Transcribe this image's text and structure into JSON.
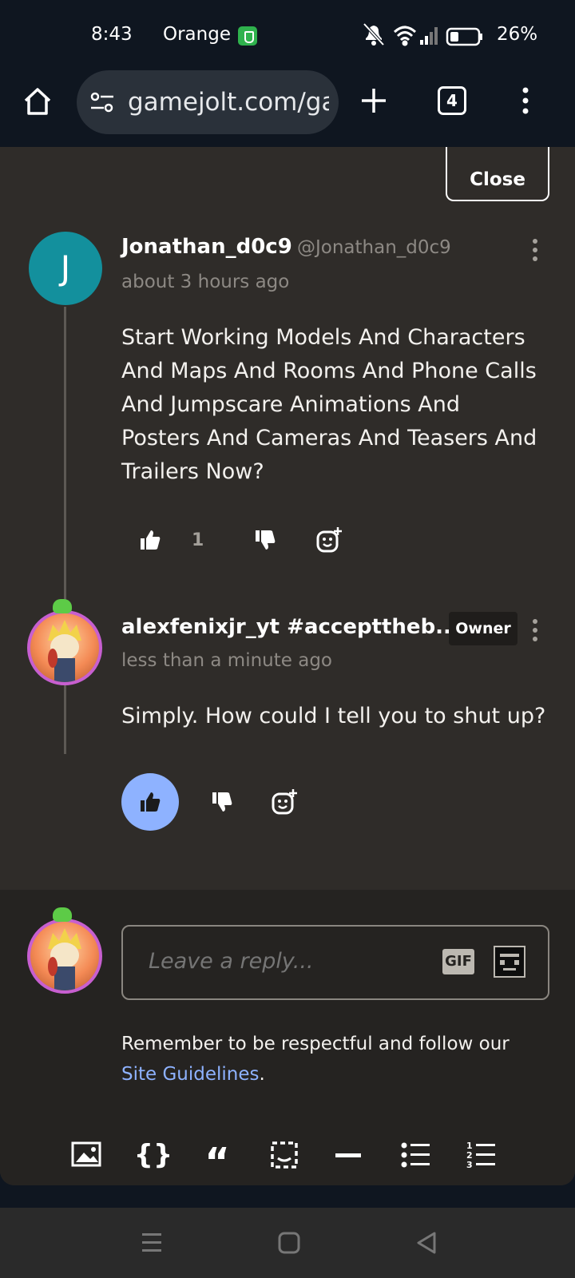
{
  "status_bar": {
    "time": "8:43",
    "carrier": "Orange",
    "battery": "26%"
  },
  "browser": {
    "url": "gamejolt.com/gai",
    "tab_count": "4"
  },
  "panel": {
    "close_label": "Close"
  },
  "comments": [
    {
      "avatar_letter": "J",
      "username": "Jonathan_d0c9",
      "handle": "@Jonathan_d0c9",
      "timestamp": "about 3 hours ago",
      "body": "Start Working Models And Characters And Maps And Rooms And Phone Calls And Jumpscare Animations And Posters And Cameras And Teasers And Trailers Now?",
      "like_count": "1"
    },
    {
      "username": "alexfenixjr_yt #accepttheb...",
      "badge": "Owner",
      "timestamp": "less than a minute ago",
      "body": "Simply. How could I tell you to shut up?",
      "liked": true
    }
  ],
  "reply": {
    "placeholder": "Leave a reply...",
    "gif_label": "GIF",
    "guidelines_text": "Remember to be respectful and follow our ",
    "guidelines_link": "Site Guidelines",
    "guidelines_end": "."
  },
  "editor_toolbar": {
    "items": [
      "image-icon",
      "code-icon",
      "quote-icon",
      "spoiler-icon",
      "divider-icon",
      "bullet-list-icon",
      "numbered-list-icon"
    ]
  },
  "colors": {
    "accent": "#8eb2ff",
    "avatar_teal": "#13909d",
    "panel_bg": "#2f2c29"
  }
}
